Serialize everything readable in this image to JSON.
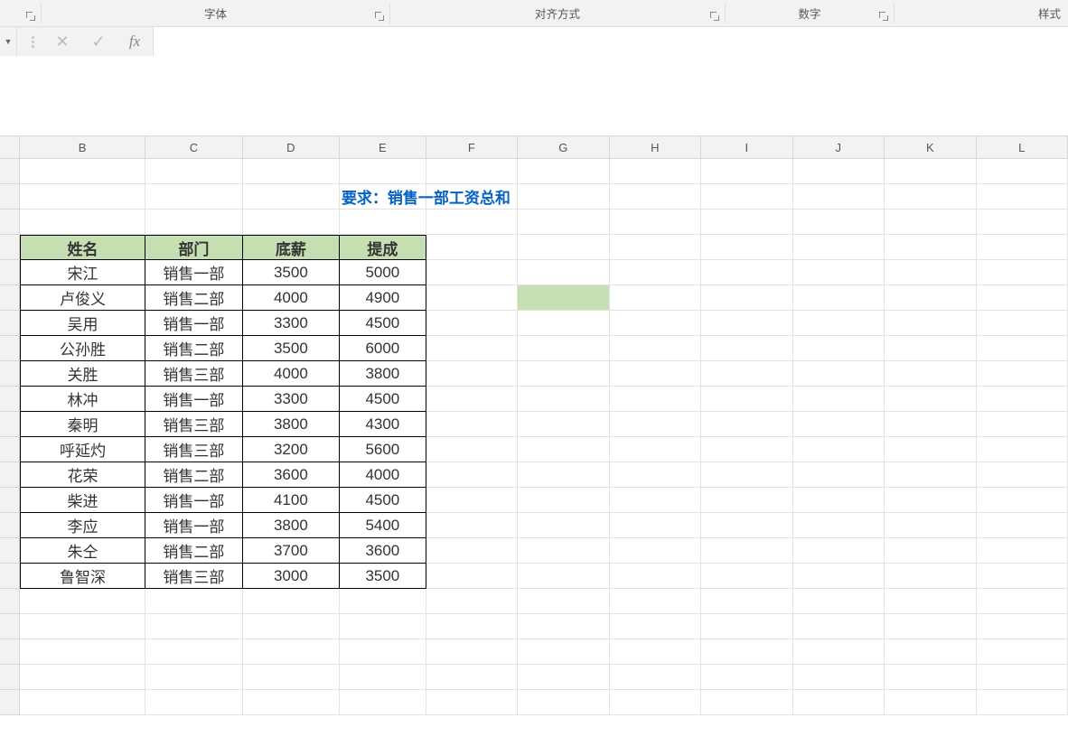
{
  "ribbon": {
    "groups": {
      "font": "字体",
      "alignment": "对齐方式",
      "number": "数字",
      "styles": "样式"
    }
  },
  "formula_bar": {
    "value": ""
  },
  "columns": [
    "B",
    "C",
    "D",
    "E",
    "F",
    "G",
    "H",
    "I",
    "J",
    "K",
    "L"
  ],
  "requirement_text": "要求：销售一部工资总和",
  "table": {
    "headers": {
      "name": "姓名",
      "dept": "部门",
      "base": "底薪",
      "bonus": "提成"
    },
    "rows": [
      {
        "name": "宋江",
        "dept": "销售一部",
        "base": "3500",
        "bonus": "5000"
      },
      {
        "name": "卢俊义",
        "dept": "销售二部",
        "base": "4000",
        "bonus": "4900"
      },
      {
        "name": "吴用",
        "dept": "销售一部",
        "base": "3300",
        "bonus": "4500"
      },
      {
        "name": "公孙胜",
        "dept": "销售二部",
        "base": "3500",
        "bonus": "6000"
      },
      {
        "name": "关胜",
        "dept": "销售三部",
        "base": "4000",
        "bonus": "3800"
      },
      {
        "name": "林冲",
        "dept": "销售一部",
        "base": "3300",
        "bonus": "4500"
      },
      {
        "name": "秦明",
        "dept": "销售三部",
        "base": "3800",
        "bonus": "4300"
      },
      {
        "name": "呼延灼",
        "dept": "销售三部",
        "base": "3200",
        "bonus": "5600"
      },
      {
        "name": "花荣",
        "dept": "销售二部",
        "base": "3600",
        "bonus": "4000"
      },
      {
        "name": "柴进",
        "dept": "销售一部",
        "base": "4100",
        "bonus": "4500"
      },
      {
        "name": "李应",
        "dept": "销售一部",
        "base": "3800",
        "bonus": "5400"
      },
      {
        "name": "朱仝",
        "dept": "销售二部",
        "base": "3700",
        "bonus": "3600"
      },
      {
        "name": "鲁智深",
        "dept": "销售三部",
        "base": "3000",
        "bonus": "3500"
      }
    ]
  }
}
